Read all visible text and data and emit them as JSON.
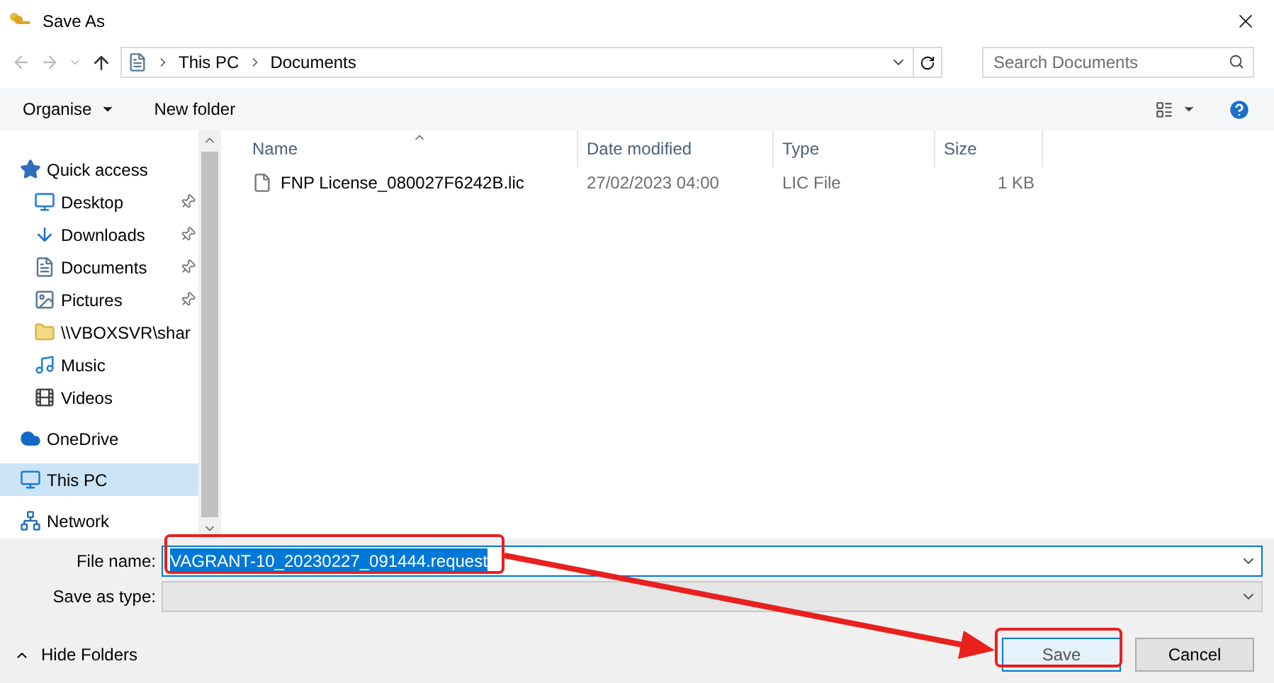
{
  "window": {
    "title": "Save As"
  },
  "address_bar": {
    "path": [
      "This PC",
      "Documents"
    ]
  },
  "search": {
    "placeholder": "Search Documents"
  },
  "toolbar": {
    "organise": "Organise",
    "new_folder": "New folder"
  },
  "sidebar": {
    "items": [
      {
        "label": "Quick access",
        "selected": false,
        "children": [
          {
            "label": "Desktop",
            "pinned": true,
            "selected": false
          },
          {
            "label": "Downloads",
            "pinned": true,
            "selected": false
          },
          {
            "label": "Documents",
            "pinned": true,
            "selected": false
          },
          {
            "label": "Pictures",
            "pinned": true,
            "selected": false
          },
          {
            "label": "\\\\VBOXSVR\\shar",
            "pinned": false,
            "selected": false
          },
          {
            "label": "Music",
            "pinned": false,
            "selected": false
          },
          {
            "label": "Videos",
            "pinned": false,
            "selected": false
          }
        ]
      },
      {
        "label": "OneDrive",
        "selected": false
      },
      {
        "label": "This PC",
        "selected": true
      },
      {
        "label": "Network",
        "selected": false
      }
    ]
  },
  "table": {
    "columns": [
      "Name",
      "Date modified",
      "Type",
      "Size"
    ],
    "rows": [
      {
        "name": "FNP License_080027F6242B.lic",
        "date": "27/02/2023 04:00",
        "type": "LIC File",
        "size": "1 KB"
      }
    ]
  },
  "file_name": {
    "label": "File name:",
    "value": "VAGRANT-10_20230227_091444.request"
  },
  "save_as_type": {
    "label": "Save as type:",
    "disabled": true
  },
  "hide_folders": "Hide Folders",
  "buttons": [
    {
      "label": "Save",
      "kind": "primary"
    },
    {
      "label": "Cancel",
      "kind": "secondary"
    }
  ]
}
